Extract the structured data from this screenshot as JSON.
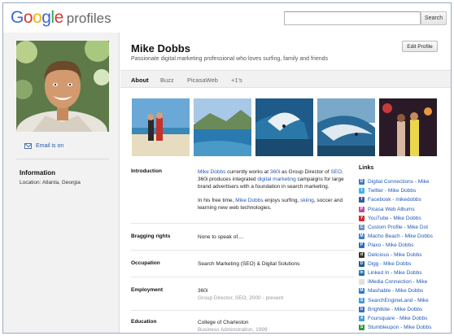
{
  "header": {
    "logo_google": "Google",
    "logo_suffix": "profiles",
    "search_placeholder": "",
    "search_button": "Search"
  },
  "left": {
    "email_link": "Email is on",
    "info_heading": "Information",
    "location_label": "Location:",
    "location_value": "Atlanta, Georgia"
  },
  "profile": {
    "name": "Mike Dobbs",
    "tagline": "Passionate digital marketing professional who loves surfing, family and friends",
    "edit_button": "Edit Profile"
  },
  "tabs": [
    "About",
    "Buzz",
    "PicasaWeb",
    "+1's"
  ],
  "photos": [
    {
      "name": "couple-on-beach"
    },
    {
      "name": "island-bay"
    },
    {
      "name": "surfer-wave-1"
    },
    {
      "name": "surfer-wave-2"
    },
    {
      "name": "couple-at-night"
    }
  ],
  "sections": {
    "introduction": {
      "label": "Introduction",
      "p1_name": "Mike Dobbs",
      "p1_a": " currently works at ",
      "p1_company": "360i",
      "p1_b": " as Group Director of ",
      "p1_seo": "SEO",
      "p1_c": ". 360i produces integrated ",
      "p1_dm": "digital marketing",
      "p1_d": " campaigns for large brand advertisers with a foundation in search marketing.",
      "p2_a": "In his free time, ",
      "p2_name": "Mike Dobbs",
      "p2_b": " enjoys surfing, ",
      "p2_skiing": "skiing",
      "p2_c": ", soccer and learning new web technologies."
    },
    "bragging": {
      "label": "Bragging rights",
      "value": "None to speak of...."
    },
    "occupation": {
      "label": "Occupation",
      "value": "Search Marketing (SEO) & Digital Solutions"
    },
    "employment": {
      "label": "Employment",
      "value": "360i",
      "sub": "Group Director, SEO, 2000 - present"
    },
    "education": {
      "label": "Education",
      "value": "College of Charleston",
      "sub": "Business Adminstration, 1999"
    }
  },
  "links": {
    "heading": "Links",
    "items": [
      {
        "label": "Digital Connections - Mike",
        "icon": "digital-connections-icon",
        "color": "#3a79c9",
        "glyph": "D"
      },
      {
        "label": "Twitter - Mike Dobbs",
        "icon": "twitter-icon",
        "color": "#45b4e6",
        "glyph": "t"
      },
      {
        "label": "Facebook - mikedobbs",
        "icon": "facebook-icon",
        "color": "#3b5998",
        "glyph": "f"
      },
      {
        "label": "Picasa Web Albums",
        "icon": "picasa-icon",
        "color": "#c04c9c",
        "glyph": "P"
      },
      {
        "label": "YouTube - Mike Dobbs",
        "icon": "youtube-icon",
        "color": "#d42a2a",
        "glyph": "Y"
      },
      {
        "label": "Custom Profile - Mike Dot",
        "icon": "custom-profile-icon",
        "color": "#6b8fc9",
        "glyph": "C"
      },
      {
        "label": "Macho Beach - Mike Dobbs",
        "icon": "macho-beach-icon",
        "color": "#3a79c9",
        "glyph": "M"
      },
      {
        "label": "Plaxo - Mike Dobbs",
        "icon": "plaxo-icon",
        "color": "#2a6cc0",
        "glyph": "P"
      },
      {
        "label": "Delicious - Mike Dobbs",
        "icon": "delicious-icon",
        "color": "#333333",
        "glyph": "d"
      },
      {
        "label": "Digg - Mike Dobbs",
        "icon": "digg-icon",
        "color": "#1a5a9a",
        "glyph": "D"
      },
      {
        "label": "Linked In - Mike Dobbs",
        "icon": "linkedin-icon",
        "color": "#1c6fa8",
        "glyph": "in"
      },
      {
        "label": "iMedia Connection - Mike",
        "icon": "imedia-icon",
        "color": "#e0e0e0",
        "glyph": ""
      },
      {
        "label": "Mashable - Mike Dobbs",
        "icon": "mashable-icon",
        "color": "#2a7ac9",
        "glyph": "M"
      },
      {
        "label": "SearchEngineLand - Mike",
        "icon": "searchengineland-icon",
        "color": "#4a9ad8",
        "glyph": "S"
      },
      {
        "label": "Brightkite - Mike Dobbs",
        "icon": "brightkite-icon",
        "color": "#3a6fc0",
        "glyph": "b"
      },
      {
        "label": "Foursquare - Mike Dobbs",
        "icon": "foursquare-icon",
        "color": "#4aa0d8",
        "glyph": "4"
      },
      {
        "label": "Stumbleupon - Mike Dobbs",
        "icon": "stumbleupon-icon",
        "color": "#2e9a3a",
        "glyph": "S"
      }
    ]
  }
}
